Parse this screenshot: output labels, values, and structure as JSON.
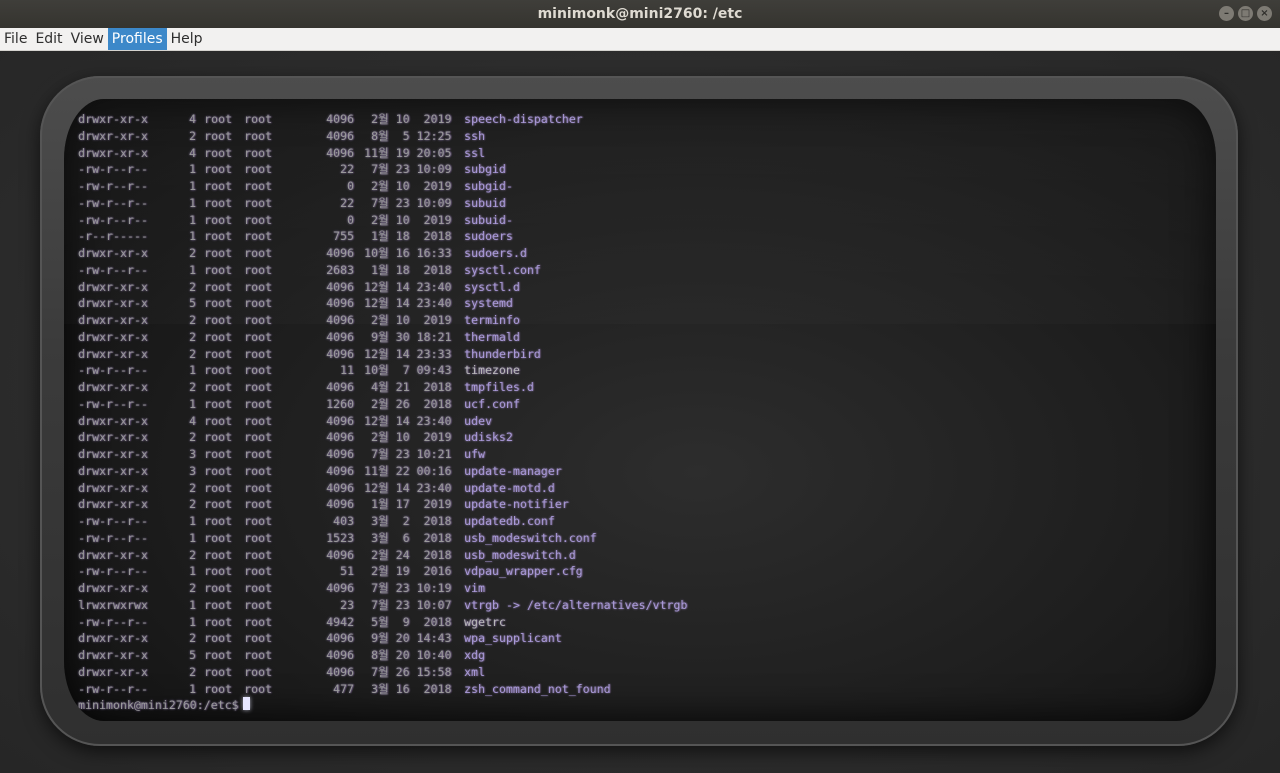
{
  "window": {
    "title": "minimonk@mini2760: /etc",
    "controls": [
      "–",
      "□",
      "×"
    ]
  },
  "menu": [
    "File",
    "Edit",
    "View",
    "Profiles",
    "Help"
  ],
  "menu_active": "Profiles",
  "terminal": {
    "rows": [
      {
        "perm": "drwxr-xr-x",
        "links": "4",
        "owner": "root",
        "group": "root",
        "size": "4096",
        "date": " 2월 10  2019",
        "name": "speech-dispatcher"
      },
      {
        "perm": "drwxr-xr-x",
        "links": "2",
        "owner": "root",
        "group": "root",
        "size": "4096",
        "date": " 8월  5 12:25",
        "name": "ssh"
      },
      {
        "perm": "drwxr-xr-x",
        "links": "4",
        "owner": "root",
        "group": "root",
        "size": "4096",
        "date": "11월 19 20:05",
        "name": "ssl"
      },
      {
        "perm": "-rw-r--r--",
        "links": "1",
        "owner": "root",
        "group": "root",
        "size": "22",
        "date": " 7월 23 10:09",
        "name": "subgid"
      },
      {
        "perm": "-rw-r--r--",
        "links": "1",
        "owner": "root",
        "group": "root",
        "size": "0",
        "date": " 2월 10  2019",
        "name": "subgid-"
      },
      {
        "perm": "-rw-r--r--",
        "links": "1",
        "owner": "root",
        "group": "root",
        "size": "22",
        "date": " 7월 23 10:09",
        "name": "subuid"
      },
      {
        "perm": "-rw-r--r--",
        "links": "1",
        "owner": "root",
        "group": "root",
        "size": "0",
        "date": " 2월 10  2019",
        "name": "subuid-"
      },
      {
        "perm": "-r--r-----",
        "links": "1",
        "owner": "root",
        "group": "root",
        "size": "755",
        "date": " 1월 18  2018",
        "name": "sudoers"
      },
      {
        "perm": "drwxr-xr-x",
        "links": "2",
        "owner": "root",
        "group": "root",
        "size": "4096",
        "date": "10월 16 16:33",
        "name": "sudoers.d"
      },
      {
        "perm": "-rw-r--r--",
        "links": "1",
        "owner": "root",
        "group": "root",
        "size": "2683",
        "date": " 1월 18  2018",
        "name": "sysctl.conf"
      },
      {
        "perm": "drwxr-xr-x",
        "links": "2",
        "owner": "root",
        "group": "root",
        "size": "4096",
        "date": "12월 14 23:40",
        "name": "sysctl.d"
      },
      {
        "perm": "drwxr-xr-x",
        "links": "5",
        "owner": "root",
        "group": "root",
        "size": "4096",
        "date": "12월 14 23:40",
        "name": "systemd"
      },
      {
        "perm": "drwxr-xr-x",
        "links": "2",
        "owner": "root",
        "group": "root",
        "size": "4096",
        "date": " 2월 10  2019",
        "name": "terminfo"
      },
      {
        "perm": "drwxr-xr-x",
        "links": "2",
        "owner": "root",
        "group": "root",
        "size": "4096",
        "date": " 9월 30 18:21",
        "name": "thermald"
      },
      {
        "perm": "drwxr-xr-x",
        "links": "2",
        "owner": "root",
        "group": "root",
        "size": "4096",
        "date": "12월 14 23:33",
        "name": "thunderbird"
      },
      {
        "perm": "-rw-r--r--",
        "links": "1",
        "owner": "root",
        "group": "root",
        "size": "11",
        "date": "10월  7 09:43",
        "name": "timezone",
        "plain": true
      },
      {
        "perm": "drwxr-xr-x",
        "links": "2",
        "owner": "root",
        "group": "root",
        "size": "4096",
        "date": " 4월 21  2018",
        "name": "tmpfiles.d"
      },
      {
        "perm": "-rw-r--r--",
        "links": "1",
        "owner": "root",
        "group": "root",
        "size": "1260",
        "date": " 2월 26  2018",
        "name": "ucf.conf"
      },
      {
        "perm": "drwxr-xr-x",
        "links": "4",
        "owner": "root",
        "group": "root",
        "size": "4096",
        "date": "12월 14 23:40",
        "name": "udev"
      },
      {
        "perm": "drwxr-xr-x",
        "links": "2",
        "owner": "root",
        "group": "root",
        "size": "4096",
        "date": " 2월 10  2019",
        "name": "udisks2"
      },
      {
        "perm": "drwxr-xr-x",
        "links": "3",
        "owner": "root",
        "group": "root",
        "size": "4096",
        "date": " 7월 23 10:21",
        "name": "ufw"
      },
      {
        "perm": "drwxr-xr-x",
        "links": "3",
        "owner": "root",
        "group": "root",
        "size": "4096",
        "date": "11월 22 00:16",
        "name": "update-manager"
      },
      {
        "perm": "drwxr-xr-x",
        "links": "2",
        "owner": "root",
        "group": "root",
        "size": "4096",
        "date": "12월 14 23:40",
        "name": "update-motd.d"
      },
      {
        "perm": "drwxr-xr-x",
        "links": "2",
        "owner": "root",
        "group": "root",
        "size": "4096",
        "date": " 1월 17  2019",
        "name": "update-notifier"
      },
      {
        "perm": "-rw-r--r--",
        "links": "1",
        "owner": "root",
        "group": "root",
        "size": "403",
        "date": " 3월  2  2018",
        "name": "updatedb.conf"
      },
      {
        "perm": "-rw-r--r--",
        "links": "1",
        "owner": "root",
        "group": "root",
        "size": "1523",
        "date": " 3월  6  2018",
        "name": "usb_modeswitch.conf"
      },
      {
        "perm": "drwxr-xr-x",
        "links": "2",
        "owner": "root",
        "group": "root",
        "size": "4096",
        "date": " 2월 24  2018",
        "name": "usb_modeswitch.d"
      },
      {
        "perm": "-rw-r--r--",
        "links": "1",
        "owner": "root",
        "group": "root",
        "size": "51",
        "date": " 2월 19  2016",
        "name": "vdpau_wrapper.cfg"
      },
      {
        "perm": "drwxr-xr-x",
        "links": "2",
        "owner": "root",
        "group": "root",
        "size": "4096",
        "date": " 7월 23 10:19",
        "name": "vim"
      },
      {
        "perm": "lrwxrwxrwx",
        "links": "1",
        "owner": "root",
        "group": "root",
        "size": "23",
        "date": " 7월 23 10:07",
        "name": "vtrgb -> /etc/alternatives/vtrgb"
      },
      {
        "perm": "-rw-r--r--",
        "links": "1",
        "owner": "root",
        "group": "root",
        "size": "4942",
        "date": " 5월  9  2018",
        "name": "wgetrc",
        "plain": true
      },
      {
        "perm": "drwxr-xr-x",
        "links": "2",
        "owner": "root",
        "group": "root",
        "size": "4096",
        "date": " 9월 20 14:43",
        "name": "wpa_supplicant"
      },
      {
        "perm": "drwxr-xr-x",
        "links": "5",
        "owner": "root",
        "group": "root",
        "size": "4096",
        "date": " 8월 20 10:40",
        "name": "xdg"
      },
      {
        "perm": "drwxr-xr-x",
        "links": "2",
        "owner": "root",
        "group": "root",
        "size": "4096",
        "date": " 7월 26 15:58",
        "name": "xml"
      },
      {
        "perm": "-rw-r--r--",
        "links": "1",
        "owner": "root",
        "group": "root",
        "size": "477",
        "date": " 3월 16  2018",
        "name": "zsh_command_not_found"
      }
    ],
    "prompt": "minimonk@mini2760:/etc$"
  }
}
